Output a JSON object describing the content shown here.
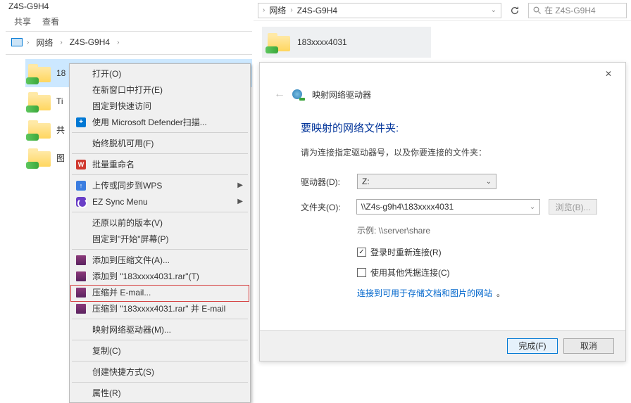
{
  "left_window": {
    "title": "Z4S-G9H4",
    "ribbon_tabs": [
      "共享",
      "查看"
    ],
    "breadcrumbs": [
      "网络",
      "Z4S-G9H4"
    ],
    "folders": [
      {
        "label": "183xxxx4031",
        "selected": true,
        "truncated": "18"
      },
      {
        "label_prefix": "Ti"
      },
      {
        "label_prefix": "共"
      },
      {
        "label_prefix": "图"
      }
    ]
  },
  "context_menu": {
    "groups": [
      [
        {
          "label": "打开(O)",
          "icon": null
        },
        {
          "label": "在新窗口中打开(E)",
          "icon": null
        },
        {
          "label": "固定到快速访问",
          "icon": null
        },
        {
          "label": "使用 Microsoft Defender扫描...",
          "icon": "shield"
        }
      ],
      [
        {
          "label": "始终脱机可用(F)",
          "icon": null
        }
      ],
      [
        {
          "label": "批量重命名",
          "icon": "wps-red"
        }
      ],
      [
        {
          "label": "上传或同步到WPS",
          "icon": "wps-blue",
          "submenu": true
        },
        {
          "label": "EZ Sync Menu",
          "icon": "ez",
          "submenu": true
        }
      ],
      [
        {
          "label": "还原以前的版本(V)",
          "icon": null
        },
        {
          "label": "固定到\"开始\"屏幕(P)",
          "icon": null
        }
      ],
      [
        {
          "label": "添加到压缩文件(A)...",
          "icon": "rar"
        },
        {
          "label": "添加到 \"183xxxx4031.rar\"(T)",
          "icon": "rar"
        },
        {
          "label": "压缩并 E-mail...",
          "icon": "rar"
        },
        {
          "label": "压缩到 \"183xxxx4031.rar\" 并 E-mail",
          "icon": "rar"
        }
      ],
      [
        {
          "label": "映射网络驱动器(M)...",
          "icon": null,
          "highlighted": true
        }
      ],
      [
        {
          "label": "复制(C)",
          "icon": null
        }
      ],
      [
        {
          "label": "创建快捷方式(S)",
          "icon": null
        }
      ],
      [
        {
          "label": "属性(R)",
          "icon": null
        }
      ]
    ]
  },
  "right_window": {
    "breadcrumbs": [
      "网络",
      "Z4S-G9H4"
    ],
    "search_placeholder": "在 Z4S-G9H4",
    "search_icon_label": "搜索",
    "folder_label": "183xxxx4031"
  },
  "dialog": {
    "header_title": "映射网络驱动器",
    "main_title": "要映射的网络文件夹:",
    "description": "请为连接指定驱动器号，以及你要连接的文件夹：",
    "drive_label": "驱动器(D):",
    "drive_value": "Z:",
    "folder_label": "文件夹(O):",
    "folder_value": "\\\\Z4s-g9h4\\183xxxx4031",
    "browse_label": "浏览(B)...",
    "example_label": "示例: \\\\server\\share",
    "check_reconnect": {
      "checked": true,
      "label": "登录时重新连接(R)"
    },
    "check_credentials": {
      "checked": false,
      "label": "使用其他凭据连接(C)"
    },
    "link_text": "连接到可用于存储文档和图片的网站",
    "link_suffix": "。",
    "btn_finish": "完成(F)",
    "btn_cancel": "取消"
  }
}
